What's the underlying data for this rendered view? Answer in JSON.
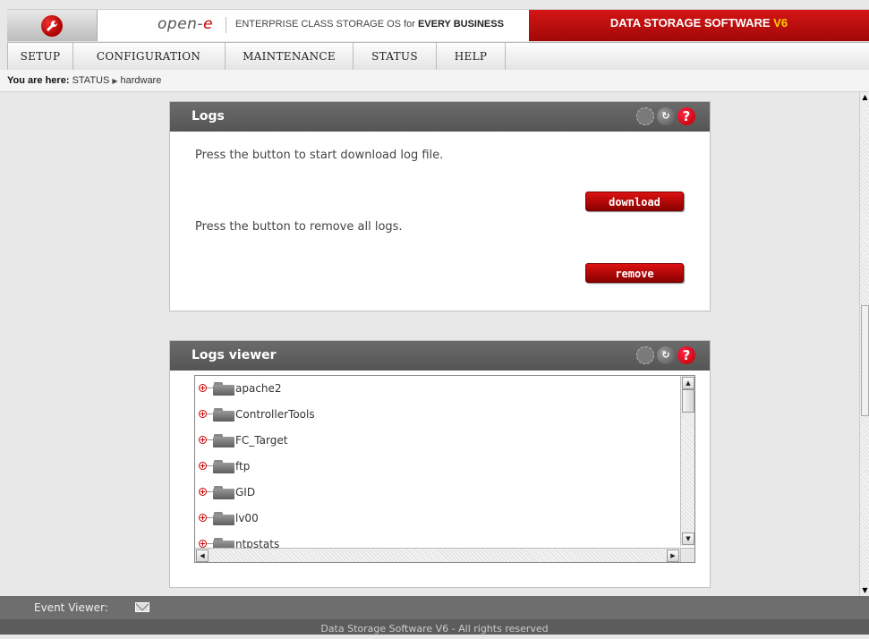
{
  "header": {
    "logo_icon": "wrench-icon",
    "brand_name_prefix": "open-",
    "brand_name_accent": "e",
    "tagline_prefix": "ENTERPRISE CLASS STORAGE OS for ",
    "tagline_bold": "EVERY BUSINESS",
    "product_name": "DATA STORAGE SOFTWARE ",
    "product_version": "V6",
    "accent_color": "#c00000",
    "version_color": "#ffd200"
  },
  "menu": {
    "items": [
      {
        "label": "SETUP"
      },
      {
        "label": "CONFIGURATION"
      },
      {
        "label": "MAINTENANCE"
      },
      {
        "label": "STATUS"
      },
      {
        "label": "HELP"
      }
    ]
  },
  "breadcrumb": {
    "label": "You are here:",
    "items": [
      "STATUS",
      "hardware"
    ]
  },
  "logs_panel": {
    "title": "Logs",
    "icons": [
      "spinner-icon",
      "refresh-icon",
      "help-icon"
    ],
    "download_text": "Press the button to start download log file.",
    "download_button": "download",
    "remove_text": "Press the button to remove all logs.",
    "remove_button": "remove"
  },
  "logs_viewer": {
    "title": "Logs viewer",
    "icons": [
      "spinner-icon",
      "refresh-icon",
      "help-icon"
    ],
    "tree_items": [
      {
        "label": "apache2"
      },
      {
        "label": "ControllerTools"
      },
      {
        "label": "FC_Target"
      },
      {
        "label": "ftp"
      },
      {
        "label": "GID"
      },
      {
        "label": "lv00"
      },
      {
        "label": "ntpstats"
      }
    ]
  },
  "event_viewer": {
    "label": "Event Viewer:",
    "icon": "envelope-icon"
  },
  "footer": {
    "text": "Data Storage Software V6 - All rights reserved"
  }
}
